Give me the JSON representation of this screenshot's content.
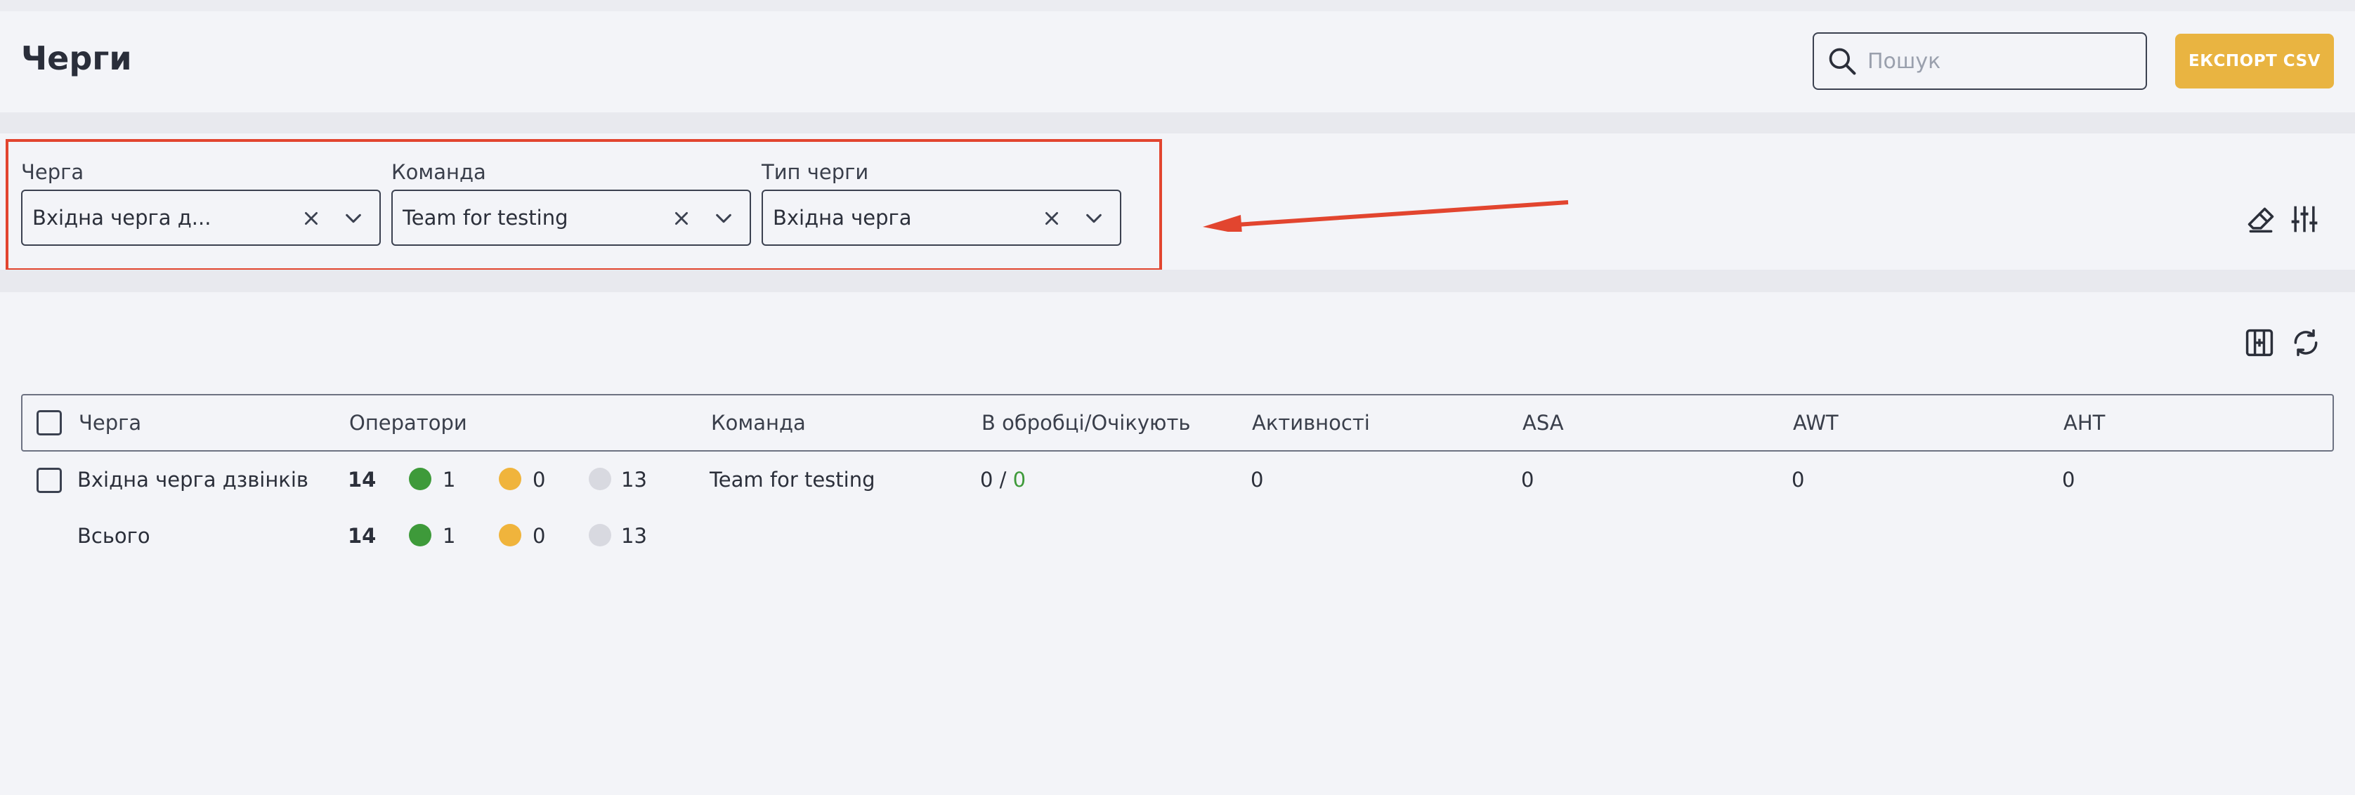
{
  "header": {
    "title": "Черги",
    "search_placeholder": "Пошук",
    "export_label": "ЕКСПОРТ CSV"
  },
  "filters": [
    {
      "label": "Черга",
      "value": "Вхідна черга д..."
    },
    {
      "label": "Команда",
      "value": "Team for testing"
    },
    {
      "label": "Тип черги",
      "value": "Вхідна черга"
    }
  ],
  "table": {
    "columns": [
      "Черга",
      "Оператори",
      "Команда",
      "В обробці/Очікують",
      "Активності",
      "ASA",
      "AWT",
      "AHT"
    ],
    "rows": [
      {
        "queue": "Вхідна черга дзвінків",
        "operators_total": "14",
        "operators_green": "1",
        "operators_yellow": "0",
        "operators_grey": "13",
        "team": "Team for testing",
        "in_progress": "0 /",
        "waiting": "0",
        "activities": "0",
        "asa": "0",
        "awt": "0",
        "aht": "0"
      }
    ],
    "total": {
      "label": "Всього",
      "operators_total": "14",
      "operators_green": "1",
      "operators_yellow": "0",
      "operators_grey": "13"
    }
  },
  "colors": {
    "accent": "#e9b441",
    "highlight": "#e2452f",
    "status_green": "#3e9a3a",
    "status_yellow": "#f0b43c",
    "status_grey": "#d8d9e0"
  },
  "icons": {
    "search": "search-icon",
    "clear": "close-icon",
    "dropdown": "chevron-down-icon",
    "eraser": "eraser-icon",
    "filter_settings": "sliders-icon",
    "columns": "columns-icon",
    "refresh": "refresh-icon"
  }
}
